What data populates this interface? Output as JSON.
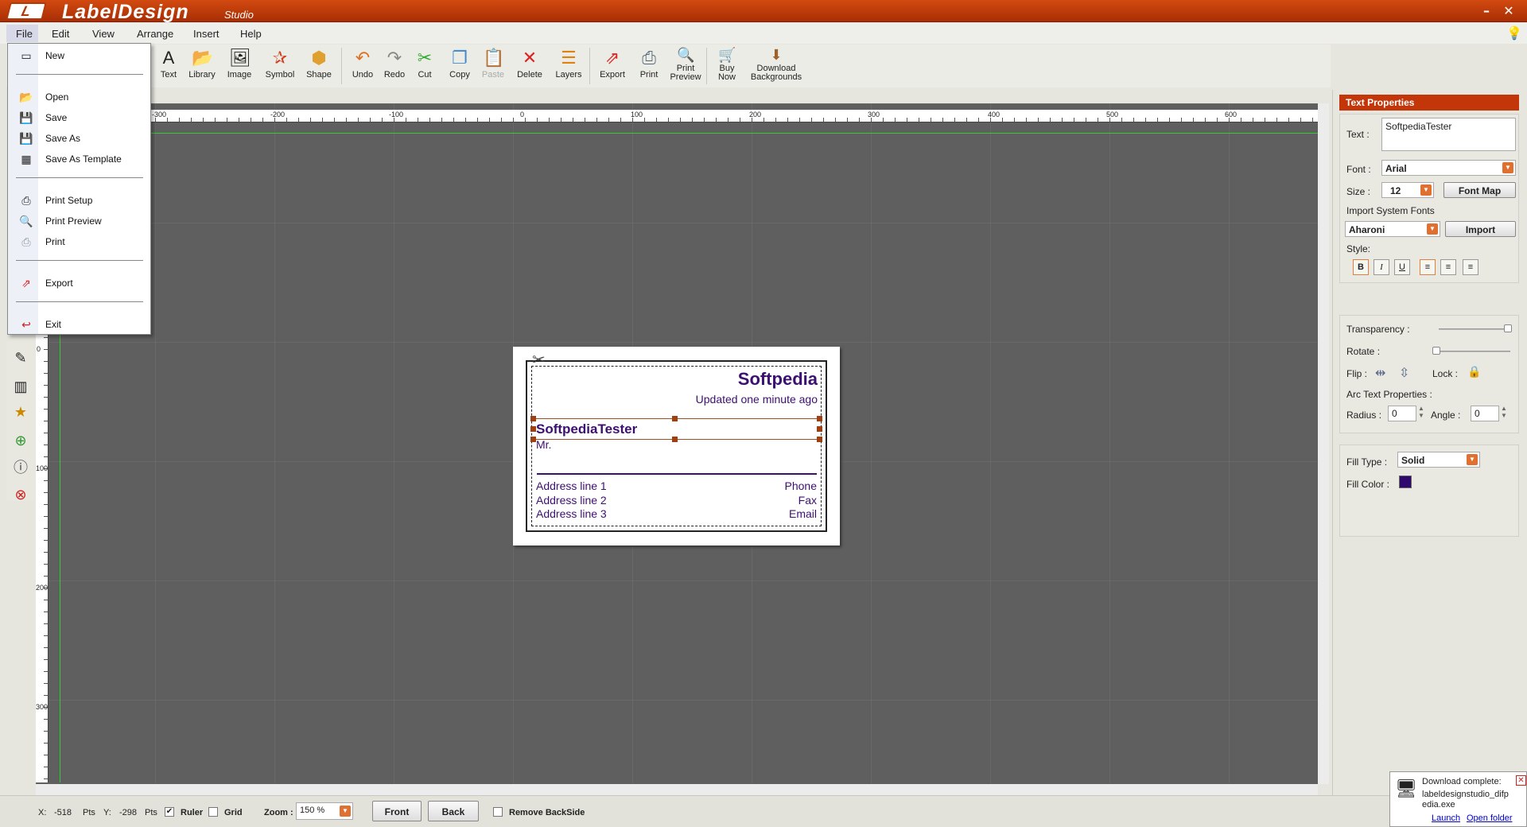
{
  "app": {
    "title": "LabelDesign",
    "subtitle": "Studio",
    "logo": "L"
  },
  "window": {
    "minimize": "–",
    "close": "✕"
  },
  "menu": [
    "File",
    "Edit",
    "View",
    "Arrange",
    "Insert",
    "Help"
  ],
  "toolbar": {
    "items": [
      {
        "label": "Text",
        "icon": "A"
      },
      {
        "label": "Library",
        "icon": "📂"
      },
      {
        "label": "Image",
        "icon": "🖼"
      },
      {
        "label": "Symbol",
        "icon": "✰"
      },
      {
        "label": "Shape",
        "icon": "⬢"
      },
      {
        "label": "Undo",
        "icon": "↶"
      },
      {
        "label": "Redo",
        "icon": "↷"
      },
      {
        "label": "Cut",
        "icon": "✂"
      },
      {
        "label": "Copy",
        "icon": "❐"
      },
      {
        "label": "Paste",
        "icon": "📋"
      },
      {
        "label": "Delete",
        "icon": "✕"
      },
      {
        "label": "Layers",
        "icon": "☰"
      },
      {
        "label": "Export",
        "icon": "⇗"
      },
      {
        "label": "Print",
        "icon": "⎙"
      },
      {
        "label1": "Print",
        "label2": "Preview",
        "icon": "🔍"
      },
      {
        "label1": "Buy",
        "label2": "Now",
        "icon": "🛒"
      },
      {
        "label1": "Download",
        "label2": "Backgrounds",
        "icon": "⬇"
      }
    ]
  },
  "ruler": {
    "h": [
      "-300",
      "-200",
      "-100",
      "0",
      "100",
      "200",
      "300",
      "400",
      "500",
      "600"
    ],
    "v": [
      "0",
      "100",
      "200",
      "300"
    ]
  },
  "file_menu": {
    "new": "New",
    "open": "Open",
    "save": "Save",
    "save_as": "Save As",
    "save_as_template": "Save As Template",
    "print_setup": "Print Setup",
    "print_preview": "Print Preview",
    "print": "Print",
    "export": "Export",
    "exit": "Exit"
  },
  "label": {
    "company": "Softpedia",
    "updated": "Updated one minute ago",
    "name": "SoftpediaTester",
    "title": "Mr.",
    "addr1": "Address line 1",
    "addr2": "Address line 2",
    "addr3": "Address line 3",
    "phone": "Phone",
    "fax": "Fax",
    "email": "Email"
  },
  "text_properties": {
    "header": "Text Properties",
    "text_label": "Text :",
    "text_value": "SoftpediaTester",
    "font_label": "Font :",
    "font_value": "Arial",
    "size_label": "Size :",
    "size_value": "12",
    "font_map": "Font Map",
    "import_label": "Import System Fonts",
    "import_font": "Aharoni",
    "import_btn": "Import",
    "style_label": "Style:",
    "bold": "B",
    "italic": "I",
    "underline": "U",
    "transparency": "Transparency :",
    "rotate": "Rotate :",
    "flip": "Flip :",
    "lock": "Lock :",
    "arc": "Arc Text Properties :",
    "radius_label": "Radius :",
    "radius_value": "0",
    "angle_label": "Angle :",
    "angle_value": "0",
    "fill_type_label": "Fill Type :",
    "fill_type_value": "Solid",
    "fill_color_label": "Fill Color :",
    "fill_color": "#2e0a6e"
  },
  "status": {
    "x_label": "X:",
    "x_value": "-518",
    "pts1": "Pts",
    "y_label": "Y:",
    "y_value": "-298",
    "pts2": "Pts",
    "ruler": "Ruler",
    "grid": "Grid",
    "zoom_label": "Zoom :",
    "zoom_value": "150 %",
    "front": "Front",
    "back": "Back",
    "remove_backside": "Remove BackSide"
  },
  "download": {
    "title": "Download complete:",
    "file": "labeldesignstudio_difpedia.exe",
    "launch": "Launch",
    "open_folder": "Open folder"
  },
  "colors": {
    "accent": "#c2360a",
    "label_text": "#3c1070"
  }
}
